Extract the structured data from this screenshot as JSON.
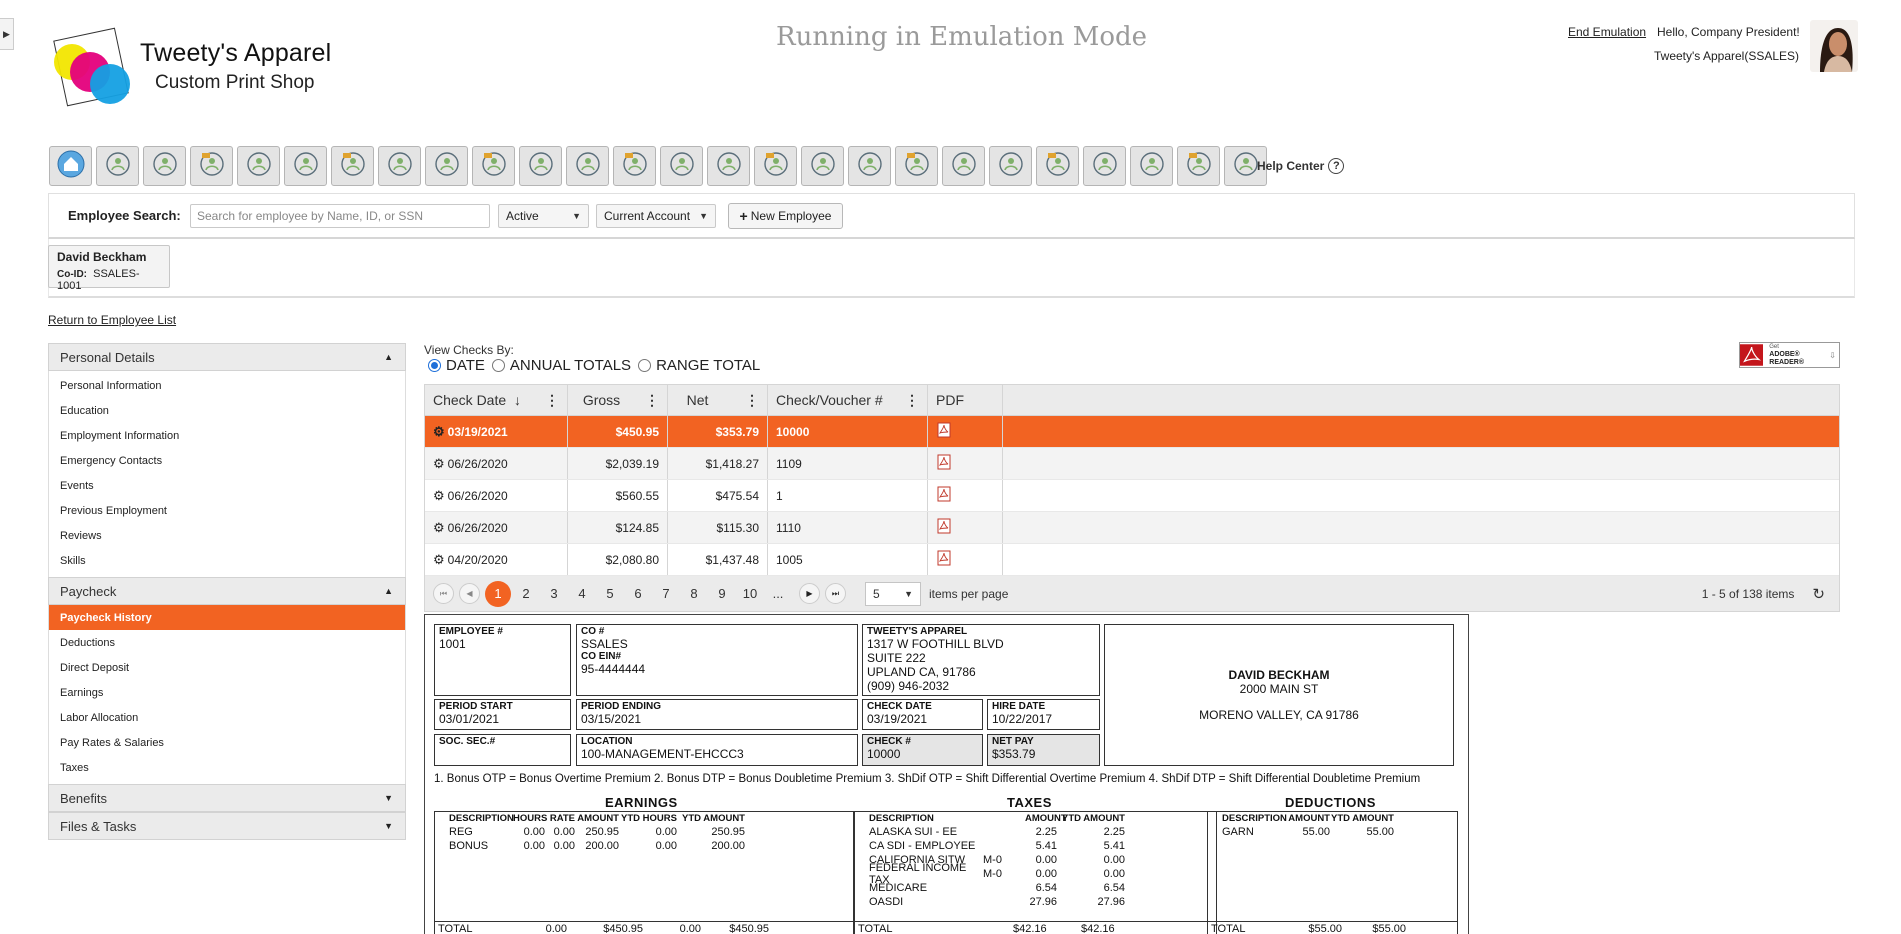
{
  "header": {
    "brand_name": "Tweety's Apparel",
    "brand_sub": "Custom Print Shop",
    "emulation_title": "Running in Emulation Mode",
    "end_emulation": "End Emulation",
    "hello": "Hello, Company President!",
    "company": "Tweety's Apparel(SSALES)"
  },
  "toolbar": {
    "icons": [
      "home-icon",
      "dashboard-icon",
      "settings-users-icon",
      "presentation-icon",
      "group-icon",
      "team-icon",
      "org-chart-icon",
      "document-icon",
      "money-bag-icon",
      "target-icon",
      "target-arrows-icon",
      "target-check-icon",
      "target-cross-icon",
      "compare-icon",
      "hand-pointer-icon",
      "shield-icon",
      "search-hand-icon",
      "search-x-icon",
      "money-bag-2-icon",
      "growth-team-icon",
      "hand-up-icon",
      "board-group-icon",
      "search-doc-icon",
      "gift-icon",
      "meeting-icon",
      "review-icon"
    ],
    "help_center": "Help Center",
    "help_glyph": "?"
  },
  "search": {
    "label": "Employee Search:",
    "placeholder": "Search for employee by Name, ID, or SSN",
    "status_value": "Active",
    "account_value": "Current Account",
    "new_employee": "New Employee",
    "new_plus": "+"
  },
  "employee": {
    "name": "David Beckham",
    "coid_label": "Co-ID:",
    "coid": "SSALES-1001"
  },
  "return_link": "Return to Employee List",
  "nav": {
    "personal_header": "Personal Details",
    "personal_items": [
      "Personal Information",
      "Education",
      "Employment Information",
      "Emergency Contacts",
      "Events",
      "Previous Employment",
      "Reviews",
      "Skills"
    ],
    "paycheck_header": "Paycheck",
    "paycheck_items": [
      "Paycheck History",
      "Deductions",
      "Direct Deposit",
      "Earnings",
      "Labor Allocation",
      "Pay Rates & Salaries",
      "Taxes"
    ],
    "benefits_header": "Benefits",
    "files_header": "Files & Tasks"
  },
  "view_checks": {
    "label": "View Checks By:",
    "options": [
      "DATE",
      "ANNUAL TOTALS",
      "RANGE TOTAL"
    ],
    "selected": "DATE"
  },
  "adobe": {
    "small": "Get",
    "big": "ADOBE® READER®"
  },
  "grid": {
    "columns": [
      "Check Date",
      "Gross",
      "Net",
      "Check/Voucher #",
      "PDF"
    ],
    "sort_glyph": "↓",
    "rows": [
      {
        "date": "03/19/2021",
        "gross": "$450.95",
        "net": "$353.79",
        "check": "10000"
      },
      {
        "date": "06/26/2020",
        "gross": "$2,039.19",
        "net": "$1,418.27",
        "check": "1109"
      },
      {
        "date": "06/26/2020",
        "gross": "$560.55",
        "net": "$475.54",
        "check": "1"
      },
      {
        "date": "06/26/2020",
        "gross": "$124.85",
        "net": "$115.30",
        "check": "1110"
      },
      {
        "date": "04/20/2020",
        "gross": "$2,080.80",
        "net": "$1,437.48",
        "check": "1005"
      }
    ],
    "pages": [
      "1",
      "2",
      "3",
      "4",
      "5",
      "6",
      "7",
      "8",
      "9",
      "10",
      "..."
    ],
    "per_page": "5",
    "per_page_label": "items per page",
    "items_info": "1 - 5 of 138 items"
  },
  "stub": {
    "employee_no_label": "EMPLOYEE #",
    "employee_no": "1001",
    "co_label": "CO #",
    "co": "SSALES",
    "co_ein_label": "CO EIN#",
    "co_ein": "95-4444444",
    "company_name": "TWEETY'S APPAREL",
    "company_addr1": "1317 W FOOTHILL BLVD",
    "company_addr2": "SUITE 222",
    "company_addr3": "UPLAND  CA,  91786",
    "company_phone": "(909) 946-2032",
    "ee_name": "DAVID BECKHAM",
    "ee_addr1": "2000 MAIN ST",
    "ee_addr2": "MORENO VALLEY, CA 91786",
    "period_start_label": "PERIOD START",
    "period_start": "03/01/2021",
    "period_end_label": "PERIOD ENDING",
    "period_end": "03/15/2021",
    "check_date_label": "CHECK DATE",
    "check_date": "03/19/2021",
    "hire_date_label": "HIRE DATE",
    "hire_date": "10/22/2017",
    "ssn_label": "SOC. SEC.#",
    "ssn": "",
    "location_label": "LOCATION",
    "location": "100-MANAGEMENT-EHCCC3",
    "check_no_label": "CHECK #",
    "check_no": "10000",
    "net_pay_label": "NET PAY",
    "net_pay": "$353.79",
    "footnote": "1. Bonus OTP = Bonus Overtime Premium 2. Bonus DTP = Bonus Doubletime Premium 3. ShDif OTP = Shift Differential Overtime Premium 4. ShDif DTP = Shift Differential Doubletime Premium",
    "earnings_title": "EARNINGS",
    "earnings_headers": [
      "DESCRIPTION",
      "HOURS",
      "RATE",
      "AMOUNT",
      "YTD HOURS",
      "YTD AMOUNT"
    ],
    "earnings_rows": [
      [
        "REG",
        "0.00",
        "0.00",
        "250.95",
        "0.00",
        "250.95"
      ],
      [
        "BONUS",
        "0.00",
        "0.00",
        "200.00",
        "0.00",
        "200.00"
      ]
    ],
    "earnings_total": [
      "TOTAL",
      "0.00",
      "$450.95",
      "0.00",
      "$450.95"
    ],
    "taxes_title": "TAXES",
    "taxes_headers": [
      "DESCRIPTION",
      "AMOUNT",
      "YTD AMOUNT"
    ],
    "taxes_rows": [
      [
        "ALASKA SUI - EE",
        "",
        "2.25",
        "2.25"
      ],
      [
        "CA SDI - EMPLOYEE",
        "",
        "5.41",
        "5.41"
      ],
      [
        "CALIFORNIA SITW",
        "M-0",
        "0.00",
        "0.00"
      ],
      [
        "FEDERAL INCOME TAX",
        "M-0",
        "0.00",
        "0.00"
      ],
      [
        "MEDICARE",
        "",
        "6.54",
        "6.54"
      ],
      [
        "OASDI",
        "",
        "27.96",
        "27.96"
      ]
    ],
    "taxes_total": [
      "TOTAL",
      "$42.16",
      "$42.16"
    ],
    "deductions_title": "DEDUCTIONS",
    "deductions_headers": [
      "DESCRIPTION",
      "AMOUNT",
      "YTD AMOUNT"
    ],
    "deductions_rows": [
      [
        "GARN",
        "55.00",
        "55.00"
      ]
    ],
    "deductions_total": [
      "TOTAL",
      "$55.00",
      "$55.00"
    ]
  },
  "colors": {
    "accent": "#f26322",
    "panel": "#ebebeb"
  }
}
